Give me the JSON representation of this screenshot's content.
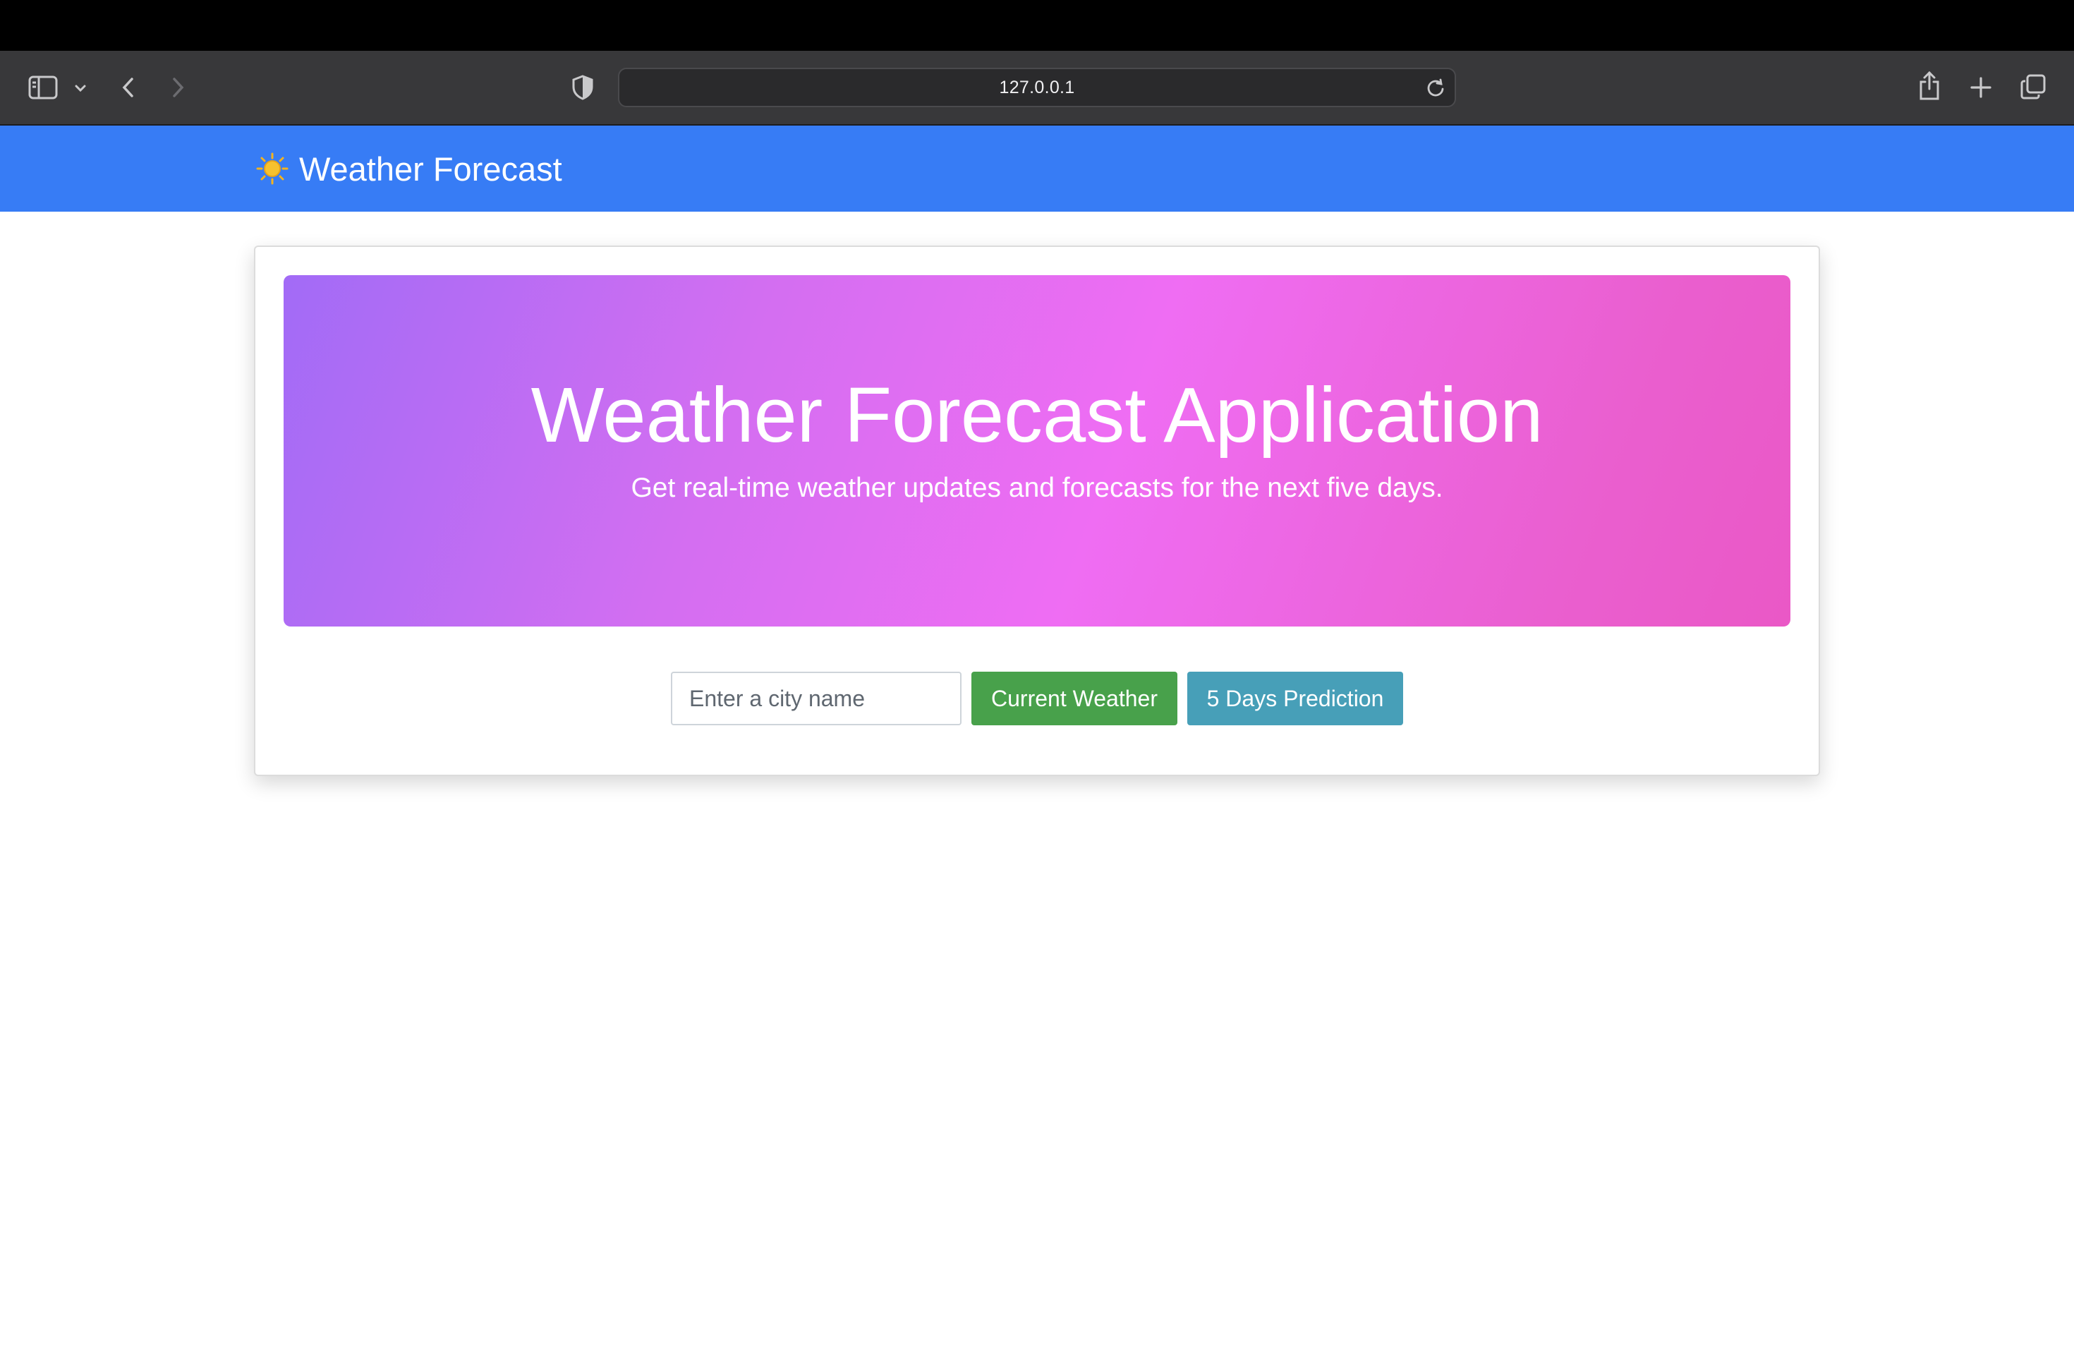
{
  "browser": {
    "url": "127.0.0.1",
    "icons": [
      "sidebar-icon",
      "chevron-down-icon",
      "back-icon",
      "forward-icon",
      "shield-icon",
      "reload-icon",
      "share-icon",
      "new-tab-icon",
      "tab-overview-icon"
    ]
  },
  "navbar": {
    "brand_icon": "sun-icon",
    "brand": "Weather Forecast",
    "color": "#377cf5"
  },
  "hero": {
    "title": "Weather Forecast Application",
    "subtitle": "Get real-time weather updates and forecasts for the next five days."
  },
  "search": {
    "placeholder": "Enter a city name",
    "value": ""
  },
  "buttons": {
    "current_weather": "Current Weather",
    "prediction": "5 Days Prediction"
  },
  "colors": {
    "current_weather_button": "#48a14b",
    "prediction_button": "#479fb8",
    "hero_gradient": [
      "#a26bf6",
      "#ef6df3",
      "#ea58c6"
    ]
  }
}
